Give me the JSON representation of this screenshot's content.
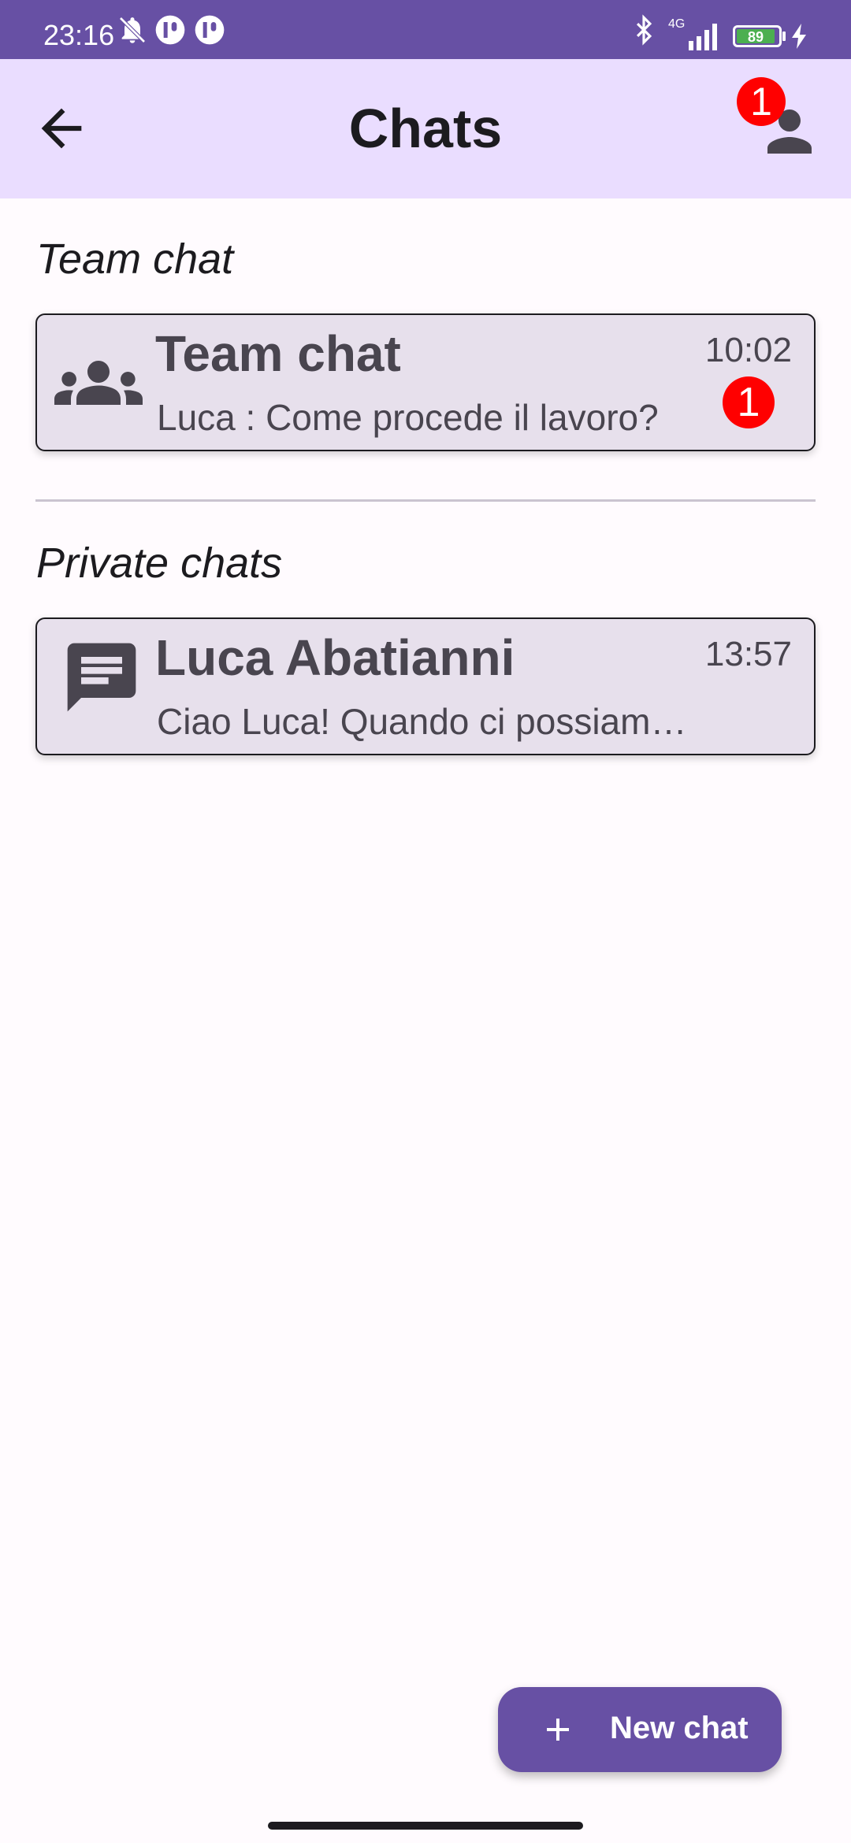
{
  "status_bar": {
    "time": "23:16",
    "battery_level": "89",
    "network": "4G"
  },
  "app_bar": {
    "title": "Chats",
    "account_badge": "1"
  },
  "sections": {
    "team": {
      "title": "Team chat",
      "chat": {
        "name": "Team chat",
        "preview": "Luca : Come procede il lavoro?",
        "time": "10:02",
        "unread": "1",
        "icon": "group-icon"
      }
    },
    "private": {
      "title": "Private chats",
      "chat": {
        "name": "Luca Abatianni",
        "preview": "Ciao Luca! Quando ci possiamo sentire?",
        "time": "13:57",
        "icon": "chat-bubble-icon"
      }
    }
  },
  "fab": {
    "label": "New chat",
    "icon": "plus-icon"
  },
  "colors": {
    "primary": "#6750a4",
    "app_bar": "#eaddff",
    "card": "#e7e0ec",
    "badge": "#ff0000"
  }
}
